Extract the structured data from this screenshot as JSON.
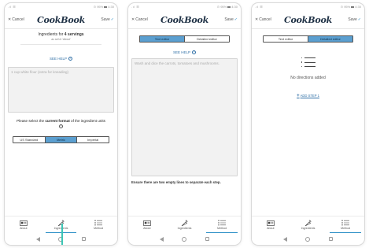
{
  "status": {
    "left": ".ıl ☰",
    "right": "⊙ 95%",
    "time": "4:30"
  },
  "header": {
    "cancel": "Cancel",
    "logo": "CookBook",
    "save": "Save"
  },
  "screens": [
    {
      "ingredients_prefix": "Ingredients for ",
      "servings": "4 servings",
      "set_in": "as set in 'About'",
      "see_help": "SEE HELP",
      "placeholder": "1 cup white flour (extra for kneading)",
      "format_prefix": "Please select the ",
      "format_bold": "current format",
      "format_suffix": " of the ingredient units",
      "units": [
        "US Standard",
        "Metric",
        "Imperial"
      ],
      "selected_unit": "Metric"
    },
    {
      "tabs": [
        "Text editor",
        "Detailed editor"
      ],
      "active_tab": "Text editor",
      "see_help": "SEE HELP",
      "placeholder": "Wash and dice the carrots, tomatoes and mushrooms.",
      "note": "Ensure there are two empty lines to separate each step."
    },
    {
      "tabs": [
        "Text editor",
        "Detailed editor"
      ],
      "active_tab": "Detailed editor",
      "empty_text": "No directions added",
      "add_step": "ADD STEP 1"
    }
  ],
  "bottom_nav": [
    "About",
    "Ingredients",
    "Method"
  ],
  "active_nav": [
    "Ingredients",
    "Method",
    "Method"
  ],
  "colors": {
    "accent": "#2c8fc7",
    "active_segment": "#5b9fd0",
    "logo": "#203246",
    "touch": "#3cc6b5"
  }
}
